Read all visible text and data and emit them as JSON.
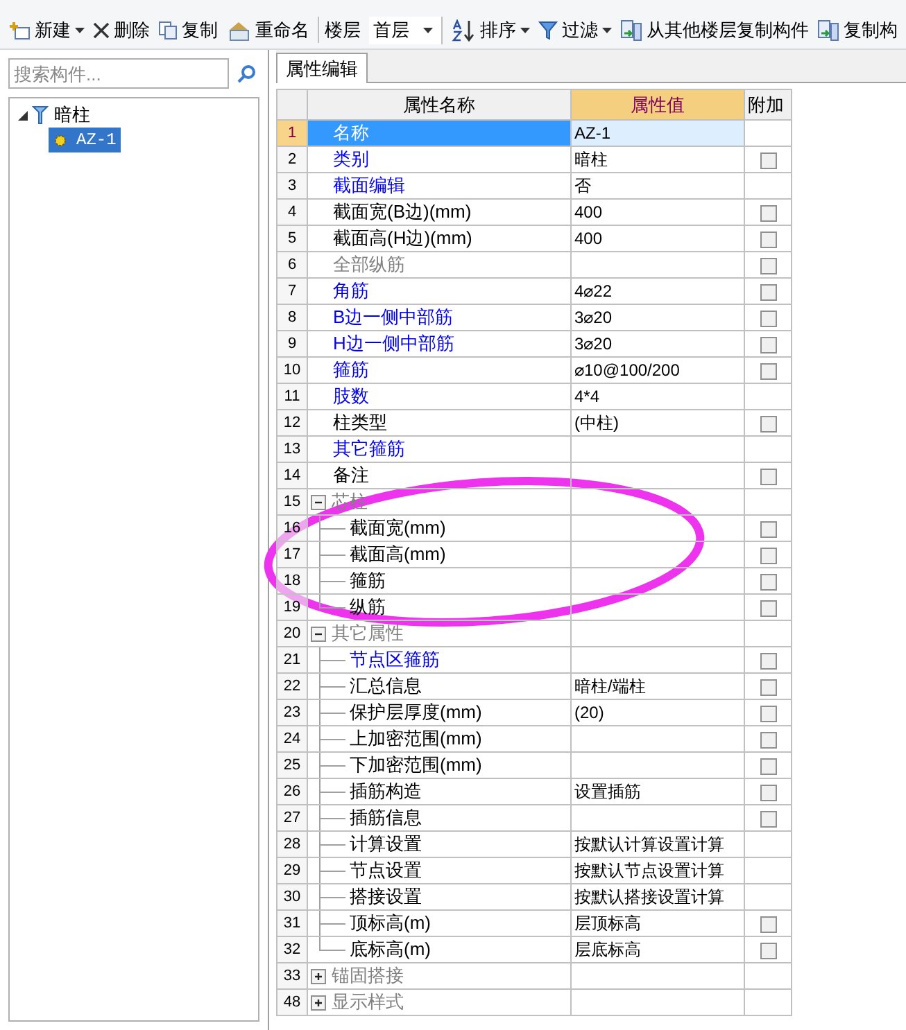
{
  "toolbar": [
    {
      "kind": "button",
      "label": "新建",
      "dropdown": true
    },
    {
      "kind": "button",
      "label": "删除",
      "dropdown": false
    },
    {
      "kind": "button",
      "label": "复制",
      "dropdown": false
    },
    {
      "kind": "button",
      "label": "重命名",
      "dropdown": false
    },
    {
      "kind": "label",
      "label": "楼层"
    },
    {
      "kind": "select",
      "label": "首层"
    },
    {
      "kind": "button",
      "label": "排序",
      "dropdown": true
    },
    {
      "kind": "button",
      "label": "过滤",
      "dropdown": true
    },
    {
      "kind": "button",
      "label": "从其他楼层复制构件",
      "dropdown": false
    },
    {
      "kind": "button",
      "label": "复制构",
      "dropdown": false
    }
  ],
  "search": {
    "placeholder": "搜索构件..."
  },
  "tree": [
    {
      "label": "暗柱",
      "expanded": true,
      "selected": false,
      "children": [
        {
          "label": "AZ-1",
          "selected": true
        }
      ]
    }
  ],
  "tab": {
    "label": "属性编辑",
    "selected": true
  },
  "grid": {
    "columns": [
      "属性名称",
      "属性值",
      "附加"
    ],
    "rows": [
      {
        "num": "1",
        "name": "名称",
        "value": "AZ-1",
        "selected": true
      },
      {
        "num": "2",
        "name": "类别",
        "value": "暗柱",
        "color": "#0000ee",
        "selected": false,
        "checked": false
      },
      {
        "num": "3",
        "name": "截面编辑",
        "value": "否",
        "color": "#0000ee",
        "selected": false
      },
      {
        "num": "4",
        "name": "截面宽(B边)(mm)",
        "value": "400",
        "color": "#000000",
        "selected": false,
        "checked": false
      },
      {
        "num": "5",
        "name": "截面高(H边)(mm)",
        "value": "400",
        "color": "#000000",
        "selected": false,
        "checked": false
      },
      {
        "num": "6",
        "name": "全部纵筋",
        "color": "#808080",
        "selected": false,
        "checked": false
      },
      {
        "num": "7",
        "name": "角筋",
        "value": "4⌀22",
        "color": "#0000ee",
        "selected": false,
        "checked": false
      },
      {
        "num": "8",
        "name": "B边一侧中部筋",
        "value": "3⌀20",
        "color": "#0000ee",
        "selected": false,
        "checked": false
      },
      {
        "num": "9",
        "name": "H边一侧中部筋",
        "value": "3⌀20",
        "color": "#0000ee",
        "selected": false,
        "checked": false
      },
      {
        "num": "10",
        "name": "箍筋",
        "value": "⌀10@100/200",
        "color": "#0000ee",
        "selected": false,
        "checked": false
      },
      {
        "num": "11",
        "name": "肢数",
        "value": "4*4",
        "color": "#0000ee",
        "selected": false
      },
      {
        "num": "12",
        "name": "柱类型",
        "value": "(中柱)",
        "color": "#000000",
        "selected": false,
        "checked": false
      },
      {
        "num": "13",
        "name": "其它箍筋",
        "color": "#0000ee",
        "selected": false
      },
      {
        "num": "14",
        "name": "备注",
        "color": "#000000",
        "selected": false,
        "checked": false
      },
      {
        "num": "15",
        "name": "芯柱",
        "color": "#808080",
        "selected": false,
        "expanded": true,
        "children": [
          {
            "num": "16",
            "name": "截面宽(mm)",
            "color": "#000000",
            "selected": false,
            "checked": false
          },
          {
            "num": "17",
            "name": "截面高(mm)",
            "color": "#000000",
            "selected": false,
            "checked": false
          },
          {
            "num": "18",
            "name": "箍筋",
            "color": "#000000",
            "selected": false,
            "checked": false
          },
          {
            "num": "19",
            "name": "纵筋",
            "color": "#000000",
            "selected": false,
            "checked": false
          }
        ]
      },
      {
        "num": "20",
        "name": "其它属性",
        "color": "#808080",
        "selected": false,
        "expanded": true,
        "children": [
          {
            "num": "21",
            "name": "节点区箍筋",
            "color": "#0000ee",
            "selected": false,
            "checked": false
          },
          {
            "num": "22",
            "name": "汇总信息",
            "value": "暗柱/端柱",
            "color": "#000000",
            "selected": false,
            "checked": false
          },
          {
            "num": "23",
            "name": "保护层厚度(mm)",
            "value": "(20)",
            "color": "#000000",
            "selected": false,
            "checked": false
          },
          {
            "num": "24",
            "name": "上加密范围(mm)",
            "color": "#000000",
            "selected": false,
            "checked": false
          },
          {
            "num": "25",
            "name": "下加密范围(mm)",
            "color": "#000000",
            "selected": false,
            "checked": false
          },
          {
            "num": "26",
            "name": "插筋构造",
            "value": "设置插筋",
            "color": "#000000",
            "selected": false,
            "checked": false
          },
          {
            "num": "27",
            "name": "插筋信息",
            "color": "#000000",
            "selected": false,
            "checked": false
          },
          {
            "num": "28",
            "name": "计算设置",
            "value": "按默认计算设置计算",
            "color": "#000000",
            "selected": false
          },
          {
            "num": "29",
            "name": "节点设置",
            "value": "按默认节点设置计算",
            "color": "#000000",
            "selected": false
          },
          {
            "num": "30",
            "name": "搭接设置",
            "value": "按默认搭接设置计算",
            "color": "#000000",
            "selected": false
          },
          {
            "num": "31",
            "name": "顶标高(m)",
            "value": "层顶标高",
            "color": "#000000",
            "selected": false,
            "checked": false
          },
          {
            "num": "32",
            "name": "底标高(m)",
            "value": "层底标高",
            "color": "#000000",
            "selected": false,
            "checked": false
          }
        ]
      },
      {
        "num": "33",
        "name": "锚固搭接",
        "color": "#808080",
        "selected": false,
        "expanded": false
      },
      {
        "num": "48",
        "name": "显示样式",
        "color": "#808080",
        "selected": false,
        "expanded": false
      }
    ]
  },
  "markup": [
    {
      "kind": "ellipse",
      "color": "#ee33ee"
    }
  ]
}
